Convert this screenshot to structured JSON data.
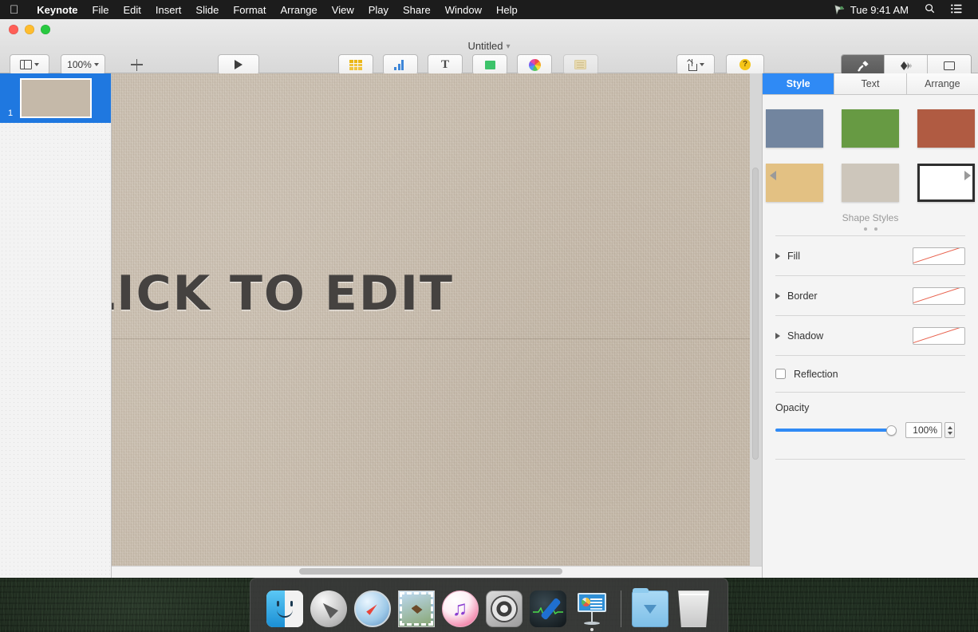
{
  "menubar": {
    "apple_icon": "apple-logo-icon",
    "items": [
      "Keynote",
      "File",
      "Edit",
      "Insert",
      "Slide",
      "Format",
      "Arrange",
      "View",
      "Play",
      "Share",
      "Window",
      "Help"
    ],
    "right": {
      "siri_icon": "siri-icon",
      "clock": "Tue 9:41 AM",
      "search_icon": "spotlight-search-icon",
      "control_center_icon": "notification-center-icon"
    }
  },
  "window": {
    "title": "Untitled",
    "title_chevron": "⌄"
  },
  "toolbar": {
    "left": [
      {
        "label": "View",
        "icon": "view-panel-icon"
      },
      {
        "label": "Zoom",
        "icon": "zoom-value",
        "value": "100%"
      },
      {
        "label": "Add Slide",
        "icon": "plus-icon"
      }
    ],
    "play": {
      "label": "Play",
      "icon": "play-triangle-icon"
    },
    "insert": [
      {
        "label": "Table",
        "icon": "table-icon"
      },
      {
        "label": "Chart",
        "icon": "chart-bar-icon"
      },
      {
        "label": "Text",
        "icon": "text-t-icon"
      },
      {
        "label": "Shape",
        "icon": "shape-square-icon"
      },
      {
        "label": "Media",
        "icon": "media-photos-icon"
      },
      {
        "label": "Comment",
        "icon": "comment-note-icon",
        "disabled": true
      }
    ],
    "right": [
      {
        "label": "Share",
        "icon": "share-export-icon"
      },
      {
        "label": "Tips",
        "icon": "tips-question-icon"
      }
    ],
    "inspector_toggles": [
      {
        "label": "Format",
        "icon": "format-paintbrush-icon",
        "active": true
      },
      {
        "label": "Animate",
        "icon": "animate-diamond-icon",
        "active": false
      },
      {
        "label": "Document",
        "icon": "document-rect-icon",
        "active": false
      }
    ]
  },
  "navigator": {
    "slides": [
      {
        "number": "1",
        "selected": true
      }
    ]
  },
  "canvas": {
    "slide_title": "CLICK TO EDIT",
    "slide_background_color": "#c5b9a9",
    "scrollbars": {
      "vertical": true,
      "horizontal": true
    }
  },
  "inspector": {
    "tabs": [
      {
        "label": "Style",
        "active": true
      },
      {
        "label": "Text",
        "active": false
      },
      {
        "label": "Arrange",
        "active": false
      }
    ],
    "shape_styles": {
      "caption": "Shape Styles",
      "swatches": [
        {
          "name": "blue-style",
          "color": "#72859f"
        },
        {
          "name": "green-style",
          "color": "#679a43"
        },
        {
          "name": "red-style",
          "color": "#b05b42"
        },
        {
          "name": "tan-style",
          "color": "#e3c183"
        },
        {
          "name": "gray-style",
          "color": "#cdc6bb"
        },
        {
          "name": "sketch-style",
          "color": "#ffffff"
        }
      ],
      "prev_arrow": "chevron-left-icon",
      "next_arrow": "chevron-right-icon",
      "page_dots": 2
    },
    "sections": [
      {
        "label": "Fill",
        "expanded": false,
        "preview": "diagonal-red-line"
      },
      {
        "label": "Border",
        "expanded": false,
        "preview": "diagonal-red-line"
      },
      {
        "label": "Shadow",
        "expanded": false,
        "preview": "diagonal-red-line"
      }
    ],
    "reflection": {
      "label": "Reflection",
      "checked": false
    },
    "opacity": {
      "label": "Opacity",
      "value": "100%",
      "percent": 100
    }
  },
  "dock": {
    "items": [
      {
        "name": "finder",
        "running": true
      },
      {
        "name": "launchpad",
        "running": false
      },
      {
        "name": "safari",
        "running": false
      },
      {
        "name": "mail",
        "running": false
      },
      {
        "name": "itunes",
        "running": false
      },
      {
        "name": "system-preferences",
        "running": false
      },
      {
        "name": "activity-monitor",
        "running": false
      },
      {
        "name": "keynote",
        "running": true
      },
      {
        "name": "downloads-folder",
        "running": false
      },
      {
        "name": "trash",
        "running": false
      }
    ]
  },
  "colors": {
    "accent_blue": "#2f8af5",
    "selection_blue": "#1f78e0",
    "menubar_bg": "#1c1c1c",
    "slide_bg": "#c5b9a9",
    "title_text": "#454240"
  }
}
